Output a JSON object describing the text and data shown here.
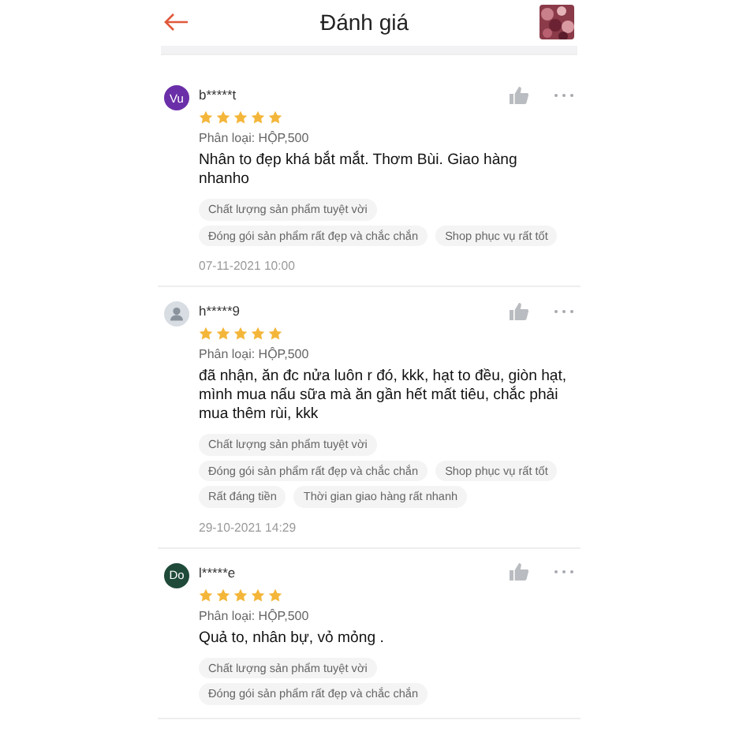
{
  "header": {
    "title": "Đánh giá"
  },
  "reviews": [
    {
      "avatar": {
        "kind": "initials",
        "text": "Vu",
        "color": "#6a2fa8"
      },
      "user": "b*****t",
      "stars": 5,
      "variant": "Phân loại: HỘP,500",
      "comment": "Nhân to đẹp khá bắt mắt. Thơm Bùi. Giao hàng nhanho",
      "tags": [
        "Chất lượng sản phẩm tuyệt vời",
        "Đóng gói sản phẩm rất đẹp và chắc chắn",
        "Shop phục vụ rất tốt"
      ],
      "date": "07-11-2021 10:00"
    },
    {
      "avatar": {
        "kind": "silhouette",
        "color": "#d8dde3"
      },
      "user": "h*****9",
      "stars": 5,
      "variant": "Phân loại: HỘP,500",
      "comment": "đã nhận, ăn đc nửa luôn r đó, kkk, hạt to đều, giòn hạt, mình mua nấu sữa mà ăn gần hết mất tiêu, chắc phải mua thêm rùi, kkk",
      "tags": [
        "Chất lượng sản phẩm tuyệt vời",
        "Đóng gói sản phẩm rất đẹp và chắc chắn",
        "Shop phục vụ rất tốt",
        "Rất đáng tiền",
        "Thời gian giao hàng rất nhanh"
      ],
      "date": "29-10-2021 14:29"
    },
    {
      "avatar": {
        "kind": "initials",
        "text": "Do",
        "color": "#1f4a3a"
      },
      "user": "l*****e",
      "stars": 5,
      "variant": "Phân loại: HỘP,500",
      "comment": "Quả to, nhân bự, vỏ mỏng .",
      "tags": [
        "Chất lượng sản phẩm tuyệt vời",
        "Đóng gói sản phẩm rất đẹp và chắc chắn"
      ]
    }
  ]
}
